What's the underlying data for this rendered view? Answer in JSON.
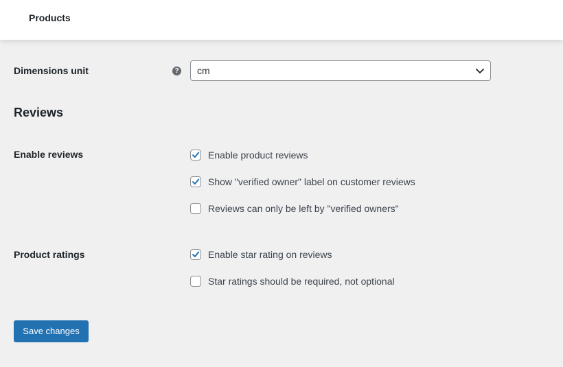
{
  "header": {
    "title": "Products"
  },
  "dimensions": {
    "label": "Dimensions unit",
    "help_icon": "question-mark-icon",
    "selected": "cm"
  },
  "reviews_section": {
    "title": "Reviews"
  },
  "enable_reviews": {
    "label": "Enable reviews",
    "options": [
      {
        "label": "Enable product reviews",
        "checked": true
      },
      {
        "label": "Show \"verified owner\" label on customer reviews",
        "checked": true
      },
      {
        "label": "Reviews can only be left by \"verified owners\"",
        "checked": false
      }
    ]
  },
  "product_ratings": {
    "label": "Product ratings",
    "options": [
      {
        "label": "Enable star rating on reviews",
        "checked": true
      },
      {
        "label": "Star ratings should be required, not optional",
        "checked": false
      }
    ]
  },
  "actions": {
    "save_label": "Save changes"
  },
  "colors": {
    "accent": "#2271b1",
    "background": "#f0f0f1",
    "text": "#1d2327"
  }
}
